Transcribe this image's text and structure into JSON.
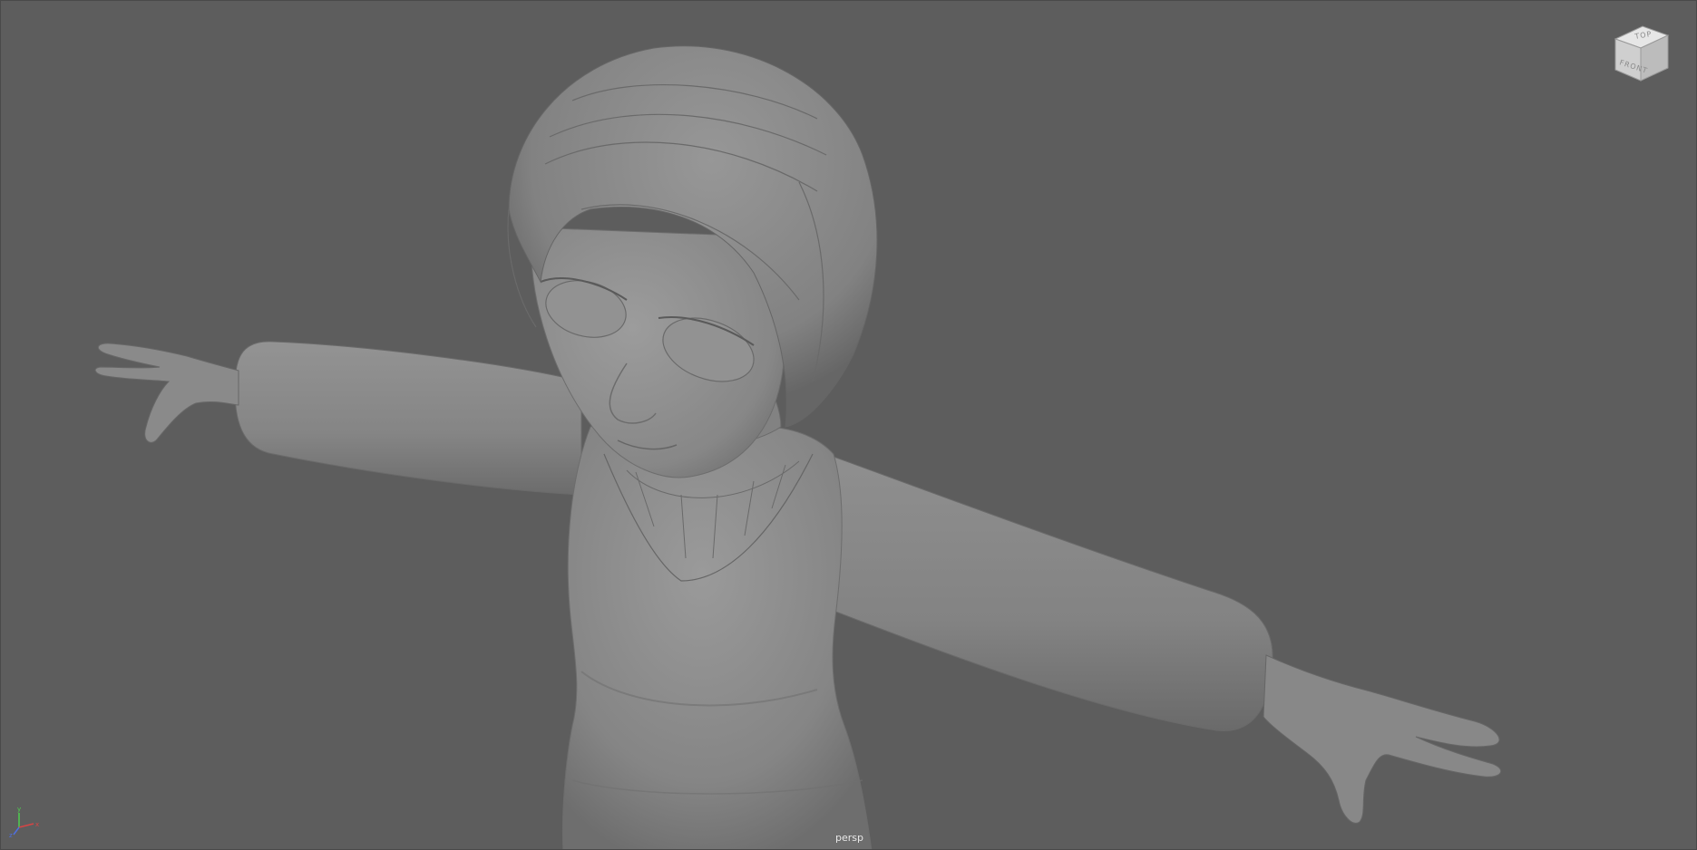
{
  "viewport": {
    "camera_name": "persp",
    "background_color": "#5d5d5d",
    "model_color": "#8c8c8c"
  },
  "viewcube": {
    "top_label": "TOP",
    "front_label": "FRONT"
  },
  "axis_gizmo": {
    "x_label": "x",
    "y_label": "y",
    "z_label": "z",
    "x_color": "#d64545",
    "y_color": "#4fcf4f",
    "z_color": "#4f6fe0"
  }
}
